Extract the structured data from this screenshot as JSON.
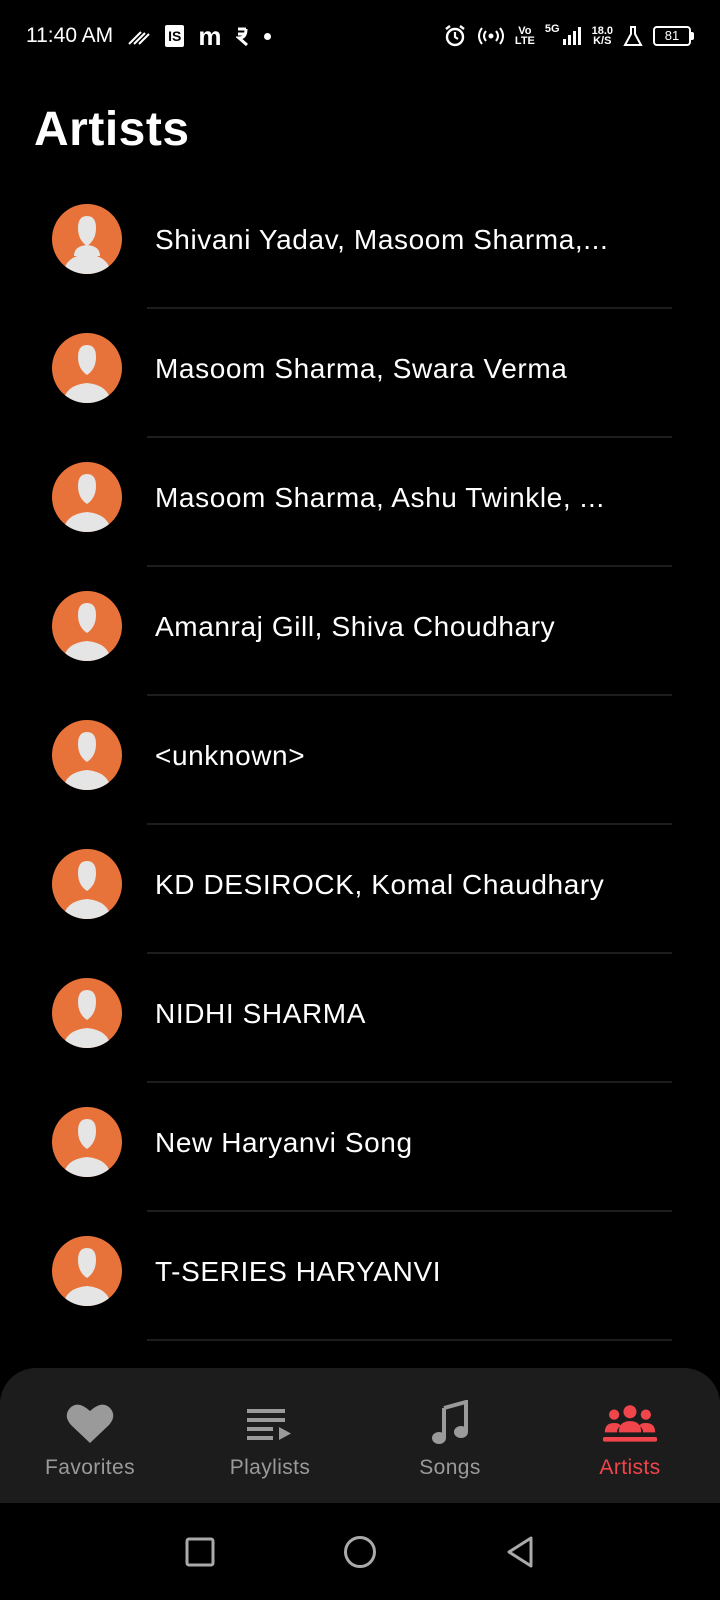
{
  "status_bar": {
    "time": "11:40 AM",
    "notif_is": "IS",
    "notif_m": "m",
    "volte_top": "Vo",
    "volte_bottom": "LTE",
    "net_type": "5G",
    "speed_top": "18.0",
    "speed_bottom": "K/S",
    "battery": "81"
  },
  "page": {
    "title": "Artists"
  },
  "artists": [
    {
      "name": "Shivani Yadav, Masoom Sharma,..."
    },
    {
      "name": "Masoom Sharma, Swara Verma"
    },
    {
      "name": "Masoom Sharma, Ashu Twinkle, ..."
    },
    {
      "name": "Amanraj Gill, Shiva Choudhary"
    },
    {
      "name": "<unknown>"
    },
    {
      "name": "KD DESIROCK, Komal Chaudhary"
    },
    {
      "name": "NIDHI SHARMA"
    },
    {
      "name": "New Haryanvi Song"
    },
    {
      "name": "T-SERIES HARYANVI"
    }
  ],
  "bottom_nav": {
    "items": [
      {
        "label": "Favorites",
        "icon": "heart-icon",
        "active": false
      },
      {
        "label": "Playlists",
        "icon": "playlist-icon",
        "active": false
      },
      {
        "label": "Songs",
        "icon": "music-note-icon",
        "active": false
      },
      {
        "label": "Artists",
        "icon": "group-icon",
        "active": true
      }
    ]
  },
  "colors": {
    "accent": "#f0454b",
    "avatar_bg": "#e8733a",
    "nav_bg": "#1c1c1c",
    "inactive": "#9a9a9a"
  }
}
